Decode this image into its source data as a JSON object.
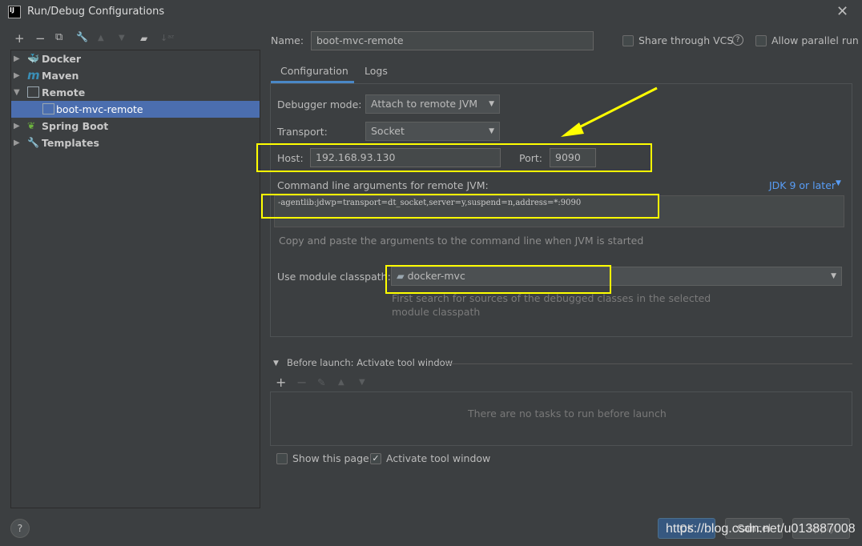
{
  "window": {
    "title": "Run/Debug Configurations"
  },
  "toolbar": {
    "add": "+",
    "remove": "−",
    "copy": "⧉",
    "edit": "🔧",
    "up": "▲",
    "down": "▼",
    "folder": "▰",
    "sort": "↓ᵃᶻ"
  },
  "tree": [
    {
      "label": "Docker",
      "expanded": false,
      "icon": "docker-icon",
      "color": "#3a9bd9"
    },
    {
      "label": "Maven",
      "expanded": false,
      "icon": "maven-icon",
      "color": "#3a8fb7"
    },
    {
      "label": "Remote",
      "expanded": true,
      "icon": "remote-icon",
      "color": "#9aa7b0"
    },
    {
      "label": "boot-mvc-remote",
      "selected": true,
      "icon": "remote-icon",
      "color": "#9aa7b0"
    },
    {
      "label": "Spring Boot",
      "expanded": false,
      "icon": "spring-boot-icon",
      "color": "#6db33f"
    },
    {
      "label": "Templates",
      "expanded": false,
      "icon": "wrench-icon",
      "color": "#bbbbbb"
    }
  ],
  "form": {
    "name_label": "Name:",
    "name_value": "boot-mvc-remote",
    "share_vcs": "Share through VCS",
    "share_vcs_checked": false,
    "allow_parallel": "Allow parallel run",
    "allow_parallel_checked": false,
    "tabs": [
      {
        "label": "Configuration",
        "active": true
      },
      {
        "label": "Logs",
        "active": false
      }
    ],
    "debugger_mode_label": "Debugger mode:",
    "debugger_mode": "Attach to remote JVM",
    "transport_label": "Transport:",
    "transport": "Socket",
    "host_label": "Host:",
    "host": "192.168.93.130",
    "port_label": "Port:",
    "port": "9090",
    "cmd_label": "Command line arguments for remote JVM:",
    "jdk_link": "JDK 9 or later",
    "cmd_value": "-agentlib:jdwp=transport=dt_socket,server=y,suspend=n,address=*:9090",
    "cmd_hint": "Copy and paste the arguments to the command line when JVM is started",
    "classpath_label": "Use module classpath:",
    "classpath": "docker-mvc",
    "classpath_hint_1": "First search for sources of the debugged classes in the selected",
    "classpath_hint_2": "module classpath"
  },
  "before_launch": {
    "title": "Before launch: Activate tool window",
    "empty": "There are no tasks to run before launch",
    "add": "+",
    "remove": "−",
    "edit": "✎",
    "up": "▲",
    "down": "▼"
  },
  "options": {
    "show_page": "Show this page",
    "show_page_checked": false,
    "activate": "Activate tool window",
    "activate_checked": true
  },
  "buttons": {
    "ok": "OK",
    "cancel": "Cancel",
    "apply": "Apply",
    "help": "?"
  },
  "watermark": "https://blog.csdn.net/u013887008",
  "colors": {
    "highlight": "#ffff00",
    "selection": "#4b6eaf",
    "link": "#589df6"
  }
}
